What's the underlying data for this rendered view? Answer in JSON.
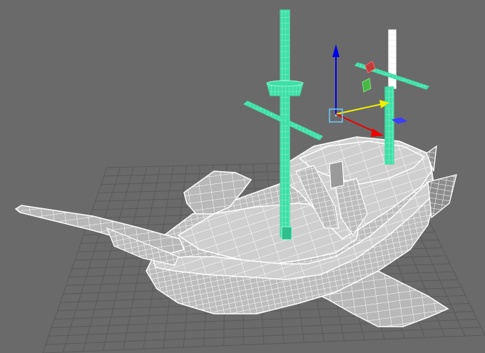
{
  "viewport": {
    "projection": "perspective",
    "display_mode": "wireframe-on-shaded",
    "background_color": "#6a6a6a",
    "grid_color": "#5a5a5a"
  },
  "scene": {
    "model": "pirate-ship",
    "mesh_color": "#ffffff",
    "selected_color": "#3ee0a8",
    "highlight_color": "#ffffff"
  },
  "gizmo": {
    "tool": "move",
    "axis_colors": {
      "x": "#ee0000",
      "y": "#0000ee",
      "z": "#eeee00"
    },
    "plane_colors": {
      "xy": "#5555ff",
      "yz": "#cc3333",
      "xz": "#55cc55"
    },
    "center_color": "#66ccff"
  }
}
